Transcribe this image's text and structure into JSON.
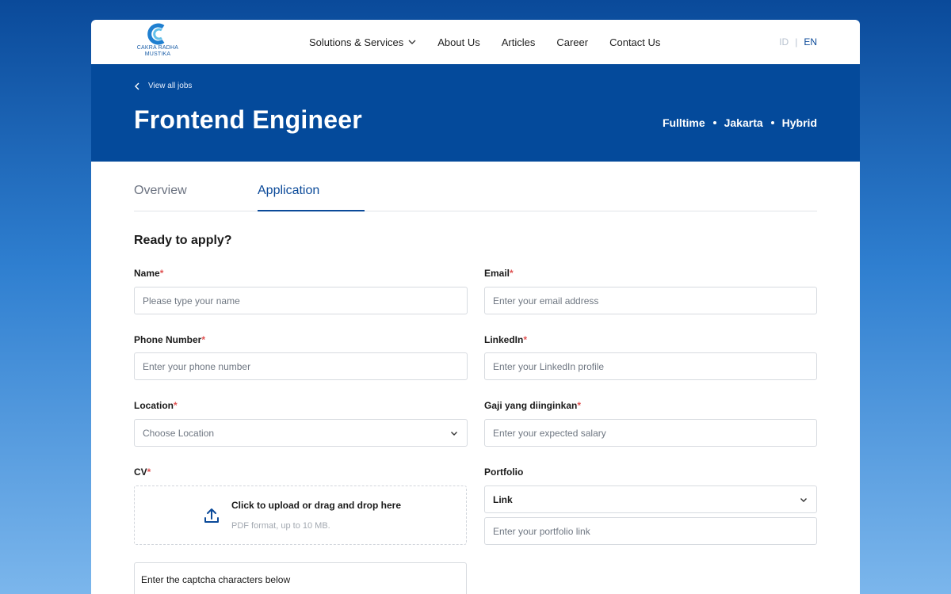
{
  "brand": {
    "line1": "CAKRA RADHA",
    "line2": "MUSTIKA"
  },
  "nav": {
    "items": [
      {
        "label": "Solutions & Services"
      },
      {
        "label": "About Us"
      },
      {
        "label": "Articles"
      },
      {
        "label": "Career"
      },
      {
        "label": "Contact Us"
      }
    ]
  },
  "lang": {
    "id": "ID",
    "separator": "|",
    "en": "EN"
  },
  "hero": {
    "back_label": "View all jobs",
    "title": "Frontend Engineer",
    "meta": [
      "Fulltime",
      "Jakarta",
      "Hybrid"
    ]
  },
  "tabs": {
    "overview": "Overview",
    "application": "Application"
  },
  "form": {
    "heading": "Ready to apply?",
    "required_mark": "*",
    "name": {
      "label": "Name",
      "placeholder": "Please type your name"
    },
    "email": {
      "label": "Email",
      "placeholder": "Enter your email address"
    },
    "phone": {
      "label": "Phone Number",
      "placeholder": "Enter your phone number"
    },
    "linkedin": {
      "label": "LinkedIn",
      "placeholder": "Enter your LinkedIn profile"
    },
    "location": {
      "label": "Location",
      "value": "Choose Location"
    },
    "salary": {
      "label": "Gaji yang diinginkan",
      "placeholder": "Enter your expected salary"
    },
    "cv": {
      "label": "CV",
      "upload_title": "Click to upload or drag and drop here",
      "upload_sub": "PDF format, up to 10 MB."
    },
    "portfolio": {
      "label": "Portfolio",
      "type_value": "Link",
      "placeholder": "Enter your portfolio link"
    },
    "captcha": {
      "label": "Enter the captcha characters below"
    }
  },
  "colors": {
    "primary": "#044a9b",
    "accent": "#0b4a99",
    "required": "#e05252"
  },
  "icons": {
    "nav_dropdown": "chevron-down-icon",
    "back": "chevron-left-icon",
    "upload": "upload-icon",
    "select": "chevron-down-icon"
  }
}
